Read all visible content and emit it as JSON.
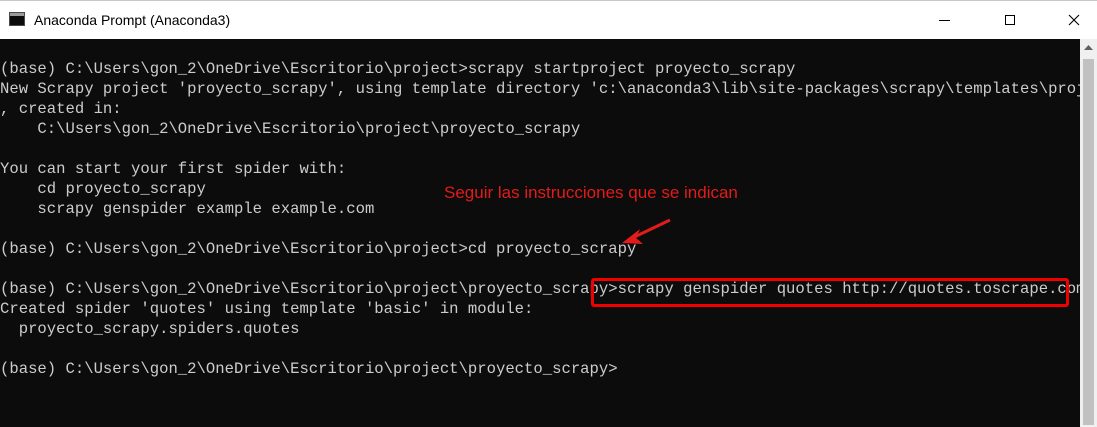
{
  "window": {
    "title": "Anaconda Prompt (Anaconda3)",
    "icon": "terminal-icon",
    "controls": [
      "minimize-icon",
      "maximize-icon",
      "close-icon"
    ]
  },
  "terminal": {
    "background": "#0c0c0c",
    "foreground": "#cccccc",
    "lines": [
      "(base) C:\\Users\\gon_2\\OneDrive\\Escritorio\\project>scrapy startproject proyecto_scrapy",
      "New Scrapy project 'proyecto_scrapy', using template directory 'c:\\anaconda3\\lib\\site-packages\\scrapy\\templates\\project'",
      ", created in:",
      "    C:\\Users\\gon_2\\OneDrive\\Escritorio\\project\\proyecto_scrapy",
      "",
      "You can start your first spider with:",
      "    cd proyecto_scrapy",
      "    scrapy genspider example example.com",
      "",
      "(base) C:\\Users\\gon_2\\OneDrive\\Escritorio\\project>cd proyecto_scrapy",
      "",
      "(base) C:\\Users\\gon_2\\OneDrive\\Escritorio\\project\\proyecto_scrapy>scrapy genspider quotes http://quotes.toscrape.com/",
      "Created spider 'quotes' using template 'basic' in module:",
      "  proyecto_scrapy.spiders.quotes",
      "",
      "(base) C:\\Users\\gon_2\\OneDrive\\Escritorio\\project\\proyecto_scrapy>"
    ]
  },
  "annotation": {
    "text": "Seguir las instrucciones que se indican",
    "color": "#e31b1b",
    "highlight_color": "#f00000"
  }
}
